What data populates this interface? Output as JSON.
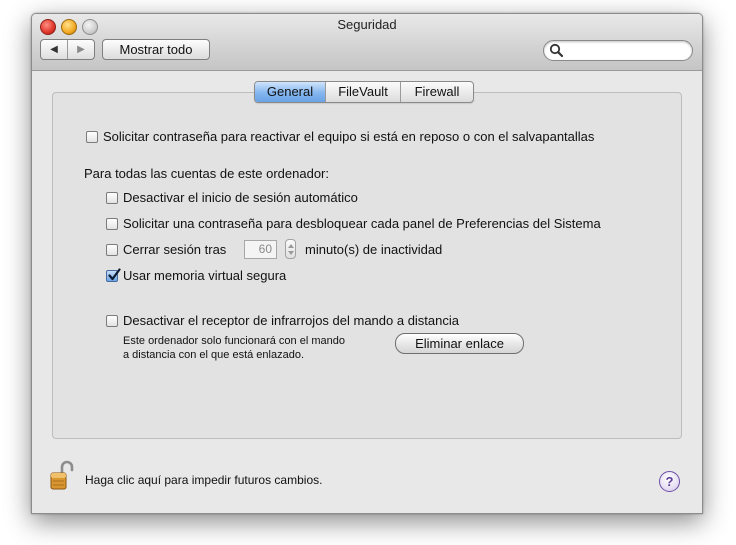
{
  "window": {
    "title": "Seguridad"
  },
  "toolbar": {
    "back_glyph": "◀",
    "forward_glyph": "▶",
    "show_all_label": "Mostrar todo",
    "search_value": "",
    "search_icon": "magnifier-icon"
  },
  "tabs": [
    {
      "label": "General",
      "selected": true
    },
    {
      "label": "FileVault",
      "selected": false
    },
    {
      "label": "Firewall",
      "selected": false
    }
  ],
  "general": {
    "require_password": {
      "label": "Solicitar contraseña para reactivar el equipo si está en reposo o con el salvapantallas",
      "checked": false
    },
    "all_accounts_heading": "Para todas las cuentas de este ordenador:",
    "disable_auto_login": {
      "label": "Desactivar el inicio de sesión automático",
      "checked": false
    },
    "require_password_prefs": {
      "label": "Solicitar una contraseña para desbloquear cada panel de Preferencias del Sistema",
      "checked": false
    },
    "logout_after": {
      "label": "Cerrar sesión tras",
      "minutes": "60",
      "suffix": "minuto(s) de inactividad",
      "checked": false
    },
    "secure_virtual_memory": {
      "label": "Usar memoria virtual segura",
      "checked": true
    },
    "disable_ir": {
      "label": "Desactivar el receptor de infrarrojos del mando a distancia",
      "checked": false
    },
    "ir_note_line1": "Este ordenador solo funcionará con el mando",
    "ir_note_line2": "a distancia con el que está enlazado.",
    "unlink_label": "Eliminar enlace"
  },
  "footer": {
    "lock_text": "Haga clic aquí para impedir futuros cambios.",
    "lock_icon": "unlocked-padlock-icon",
    "help_label": "?"
  },
  "colors": {
    "selected_tab": "#84b6ef",
    "checkbox_checked": "#6ea4e4",
    "help_button": "#5b3d99"
  }
}
